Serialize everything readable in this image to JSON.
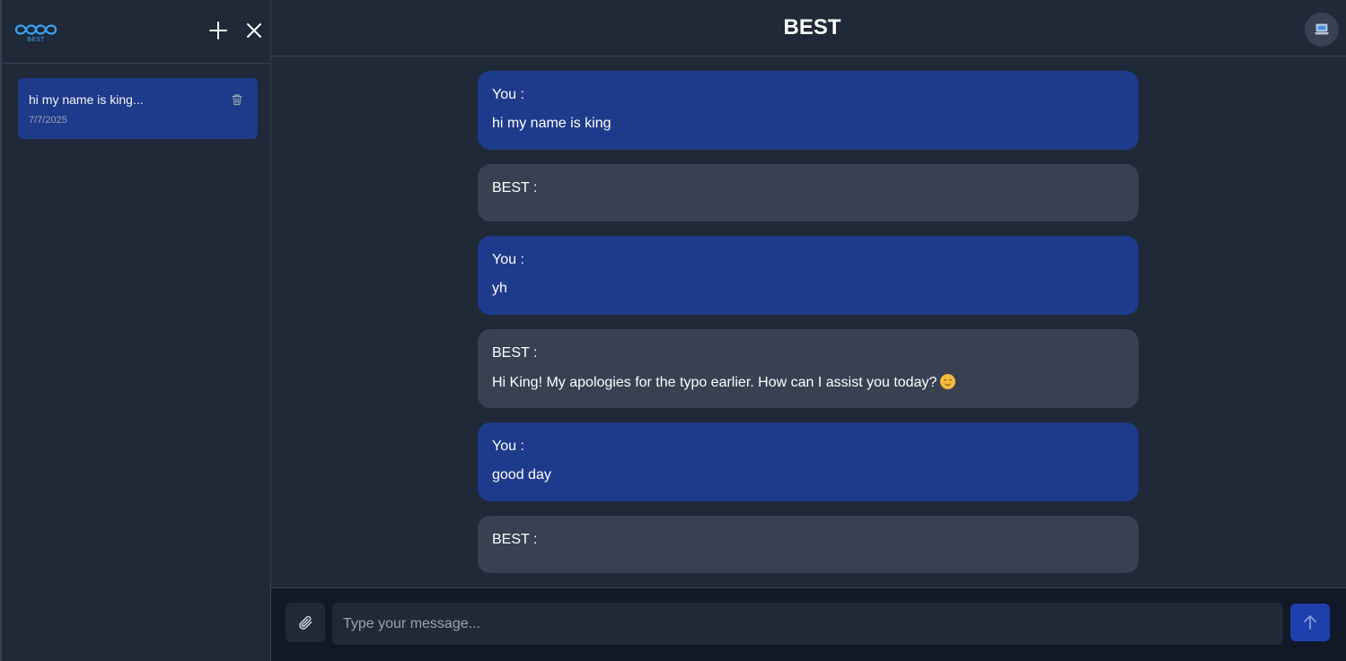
{
  "app": {
    "logo_text": "BEST",
    "title": "BEST"
  },
  "sidebar": {
    "icons": {
      "new_chat": "plus-icon",
      "close": "close-icon",
      "delete": "trash-icon"
    },
    "chats": [
      {
        "title": "hi my name is king...",
        "date": "7/7/2025"
      }
    ]
  },
  "header": {
    "avatar_icon": "laptop-icon"
  },
  "messages": [
    {
      "role": "user",
      "sender": "You :",
      "text": "hi my name is king"
    },
    {
      "role": "bot",
      "sender": "BEST :",
      "text": ""
    },
    {
      "role": "user",
      "sender": "You :",
      "text": "yh"
    },
    {
      "role": "bot",
      "sender": "BEST :",
      "text": "Hi King! My apologies for the typo earlier. How can I assist you today?"
    },
    {
      "role": "user",
      "sender": "You :",
      "text": "good day"
    },
    {
      "role": "bot",
      "sender": "BEST :",
      "text": ""
    }
  ],
  "composer": {
    "placeholder": "Type your message...",
    "attach_icon": "paperclip-icon",
    "send_icon": "arrow-up-icon"
  },
  "colors": {
    "background": "#1f2937",
    "user_bubble": "#1e3a8a",
    "bot_bubble": "#374151",
    "composer_bg": "#111827",
    "send_button": "#1e40af",
    "logo": "#38a5f5"
  }
}
